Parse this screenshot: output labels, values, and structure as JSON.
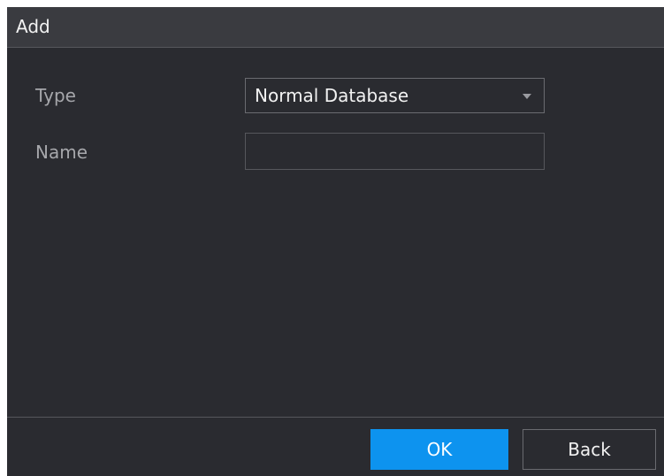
{
  "dialog": {
    "title": "Add"
  },
  "form": {
    "type_label": "Type",
    "type_value": "Normal Database",
    "name_label": "Name",
    "name_value": "",
    "name_placeholder": ""
  },
  "footer": {
    "ok_label": "OK",
    "back_label": "Back"
  },
  "colors": {
    "dialog_bg": "#2a2b30",
    "titlebar_bg": "#3a3b40",
    "primary_button": "#0d93ef",
    "label_text": "#a6a7ab",
    "value_text": "#f2f2f2"
  },
  "icons": {
    "dropdown": "chevron-down-icon"
  }
}
